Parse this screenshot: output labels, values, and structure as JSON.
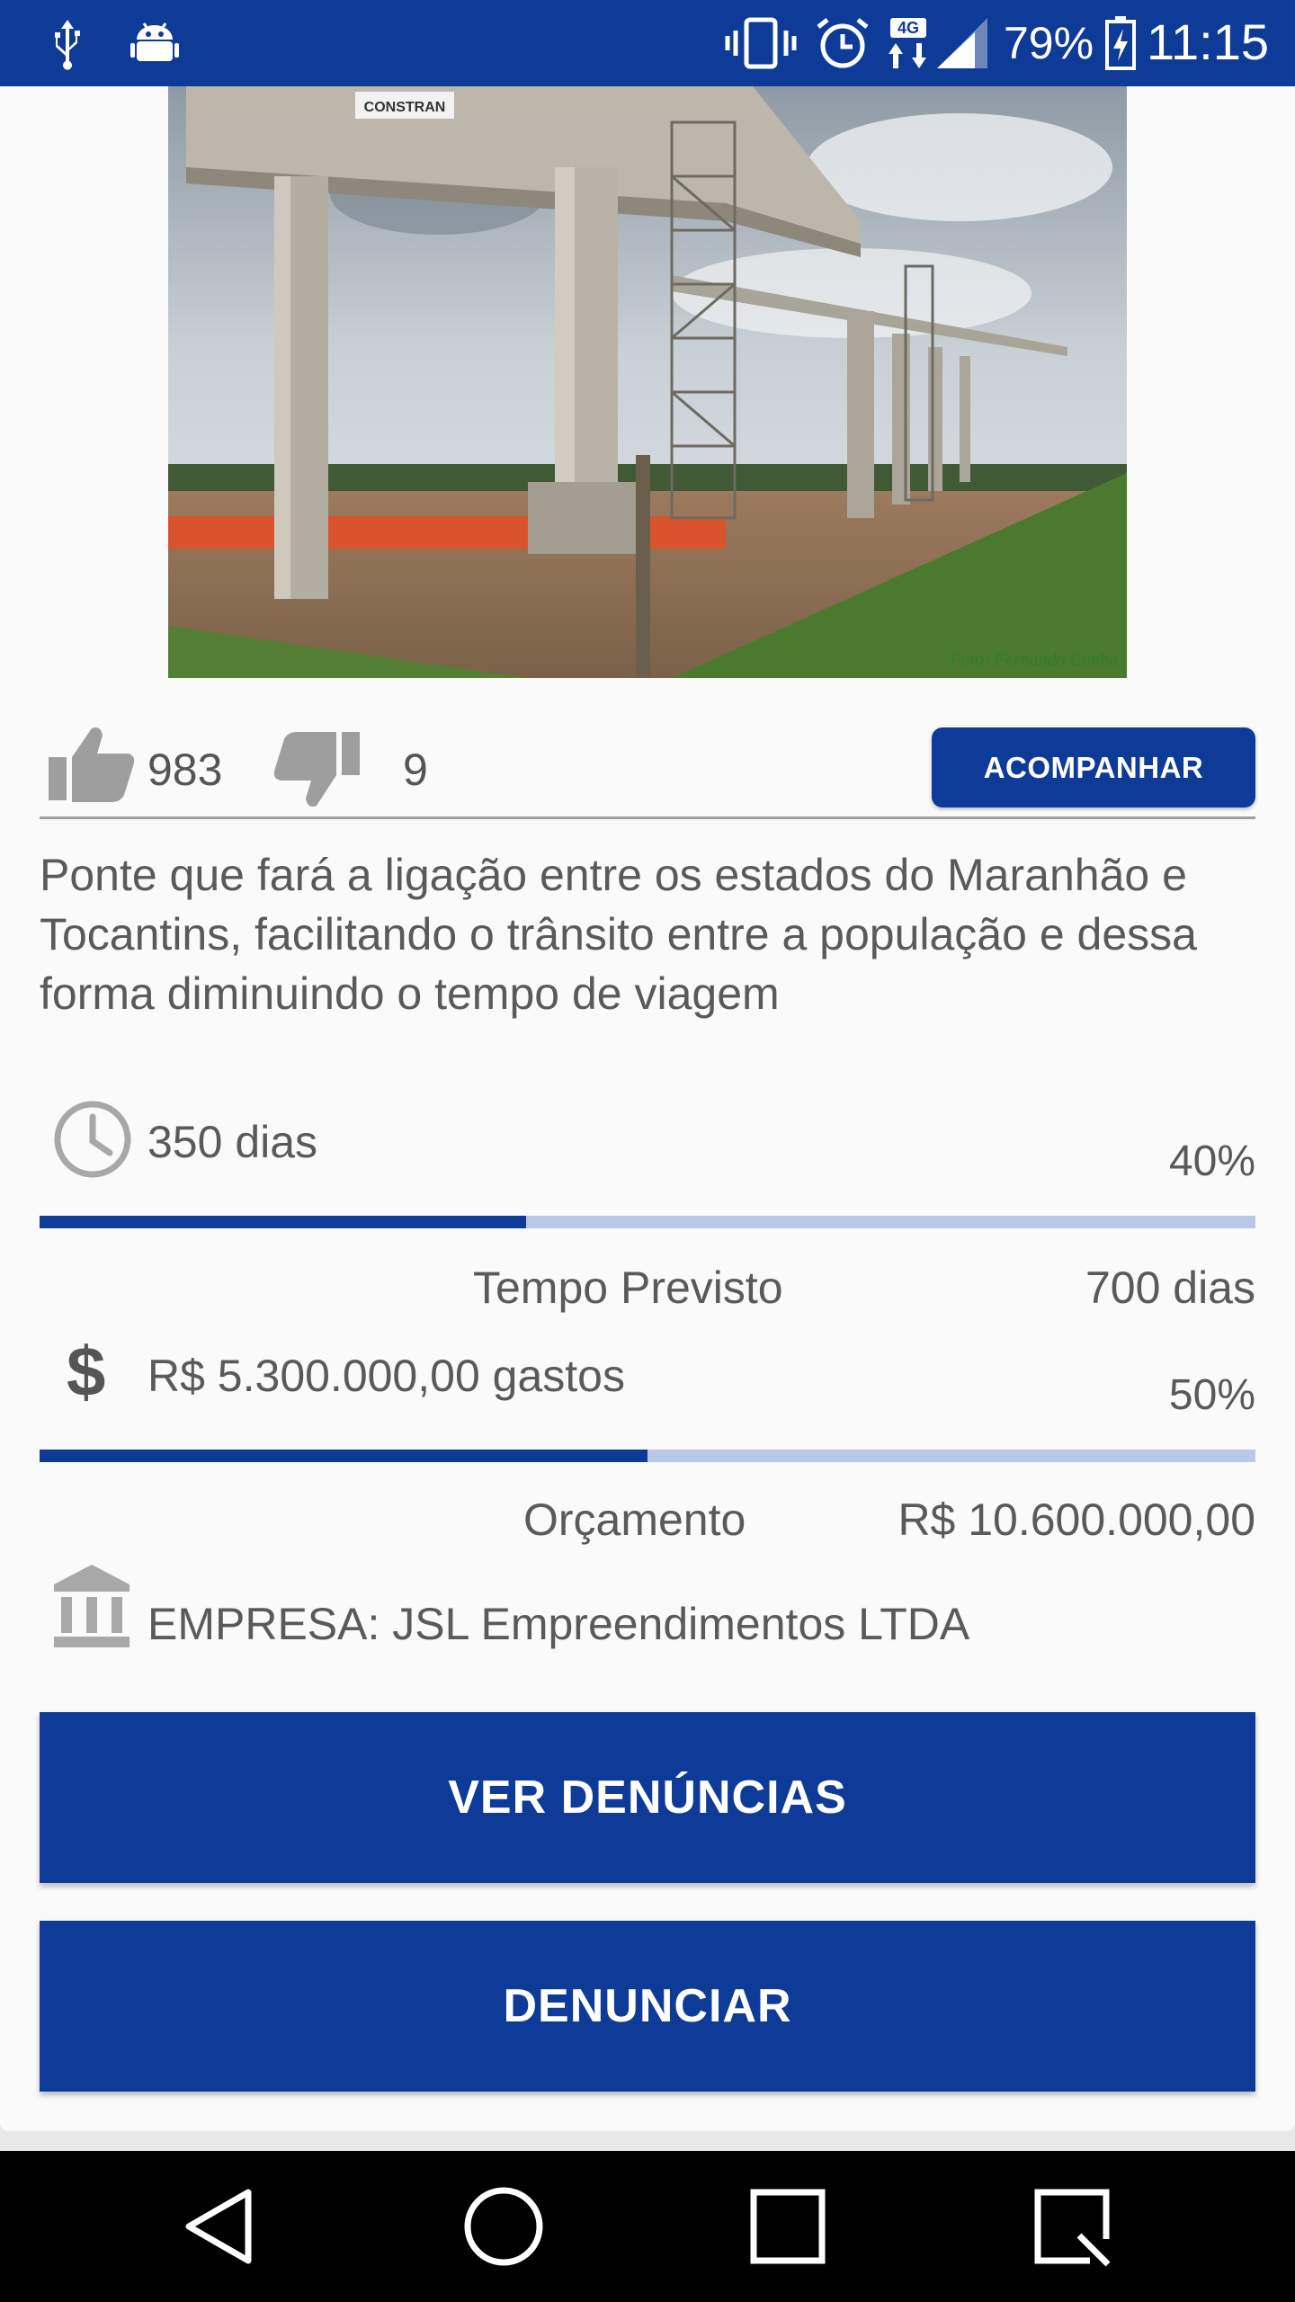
{
  "status_bar": {
    "battery_percent": "79%",
    "time": "11:15",
    "network": "4G",
    "icons": [
      "usb-icon",
      "android-debug-icon",
      "vibrate-icon",
      "alarm-icon",
      "data-4g-icon",
      "signal-icon",
      "battery-charging-icon"
    ]
  },
  "photo": {
    "credit": "Foto: Fernando Cunha",
    "sign_text": "CONSTRAN"
  },
  "reactions": {
    "likes": "983",
    "dislikes": "9",
    "follow_label": "ACOMPANHAR"
  },
  "description": "Ponte que fará a ligação entre os estados do Maranhão e Tocantins, facilitando o trânsito entre a população e dessa forma diminuindo o tempo de viagem",
  "time_info": {
    "elapsed": "350 dias",
    "percent_label": "40%",
    "progress": 0.4,
    "planned_label": "Tempo Previsto",
    "planned_value": "700 dias"
  },
  "budget_info": {
    "spent": "R$ 5.300.000,00 gastos",
    "percent_label": "50%",
    "progress": 0.5,
    "budget_label": "Orçamento",
    "budget_value": "R$ 10.600.000,00",
    "currency_symbol": "$"
  },
  "company": "EMPRESA: JSL Empreendimentos LTDA",
  "buttons": {
    "view_reports": "VER DENÚNCIAS",
    "report": "DENUNCIAR"
  },
  "colors": {
    "primary": "#0d3b97",
    "progress_track": "#b9c8e6",
    "text": "#5a5a5a"
  }
}
